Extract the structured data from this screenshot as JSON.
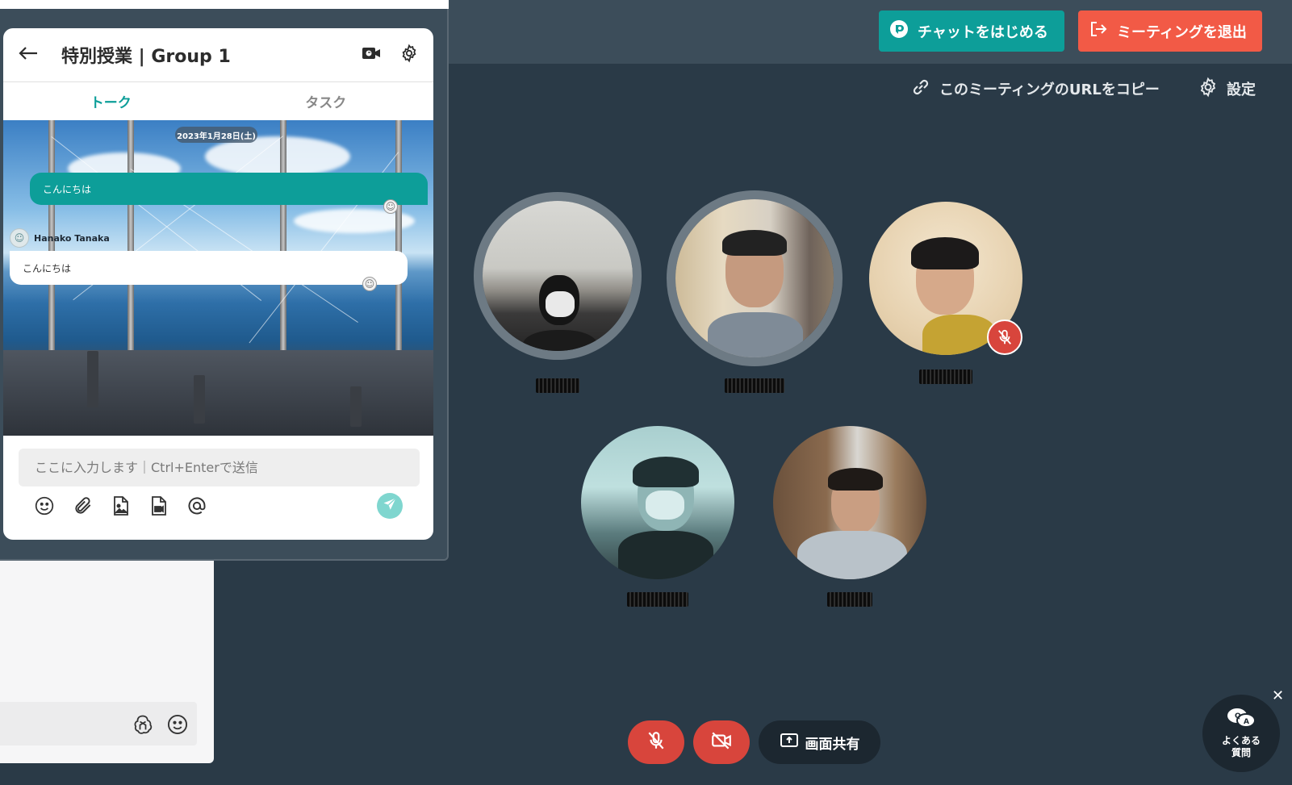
{
  "topbar": {
    "start_chat_label": "チャットをはじめる",
    "leave_meeting_label": "ミーティングを退出",
    "copy_url_label": "このミーティングのURLをコピー",
    "settings_label": "設定"
  },
  "chat": {
    "title": "特別授業 | Group 1",
    "tabs": [
      {
        "label": "トーク",
        "active": true
      },
      {
        "label": "タスク",
        "active": false
      }
    ],
    "date_label": "2023年1月28日(土)",
    "messages": [
      {
        "from": "self",
        "text": "こんにちは"
      },
      {
        "from": "Hanako Tanaka",
        "sender_name": "Hanako Tanaka",
        "text": "こんにちは"
      }
    ],
    "input_placeholder": "ここに入力します｜Ctrl+Enterで送信"
  },
  "controls": {
    "share_label": "画面共有"
  },
  "faq": {
    "label_line1": "よくある",
    "label_line2": "質問"
  },
  "colors": {
    "teal": "#0d9e99",
    "red": "#f25a46",
    "mute_red": "#d8453c",
    "background": "#2a3a47",
    "topbar": "#3c4d5a"
  }
}
